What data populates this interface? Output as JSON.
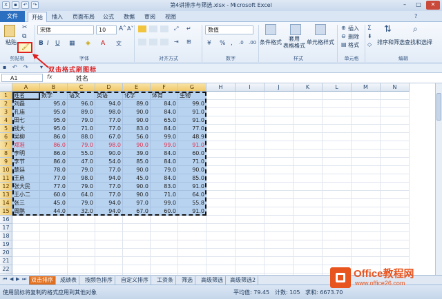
{
  "window": {
    "title": "第4讲排序与筛选.xlsx - Microsoft Excel",
    "minimize": "–",
    "maximize": "□",
    "close": "✕"
  },
  "tabs": [
    "文件",
    "开始",
    "插入",
    "页面布局",
    "公式",
    "数据",
    "审阅",
    "视图"
  ],
  "ribbon": {
    "paste": "粘贴",
    "font_name": "宋体",
    "font_size": "10",
    "number_format": "数值",
    "conditional_format": "条件格式",
    "table_format": "套用\n表格格式",
    "cell_styles": "单元格样式",
    "insert": "插入",
    "delete": "删除",
    "format": "格式",
    "sort_filter": "排序和筛选",
    "find_select": "查找和选择",
    "groups": [
      "剪贴板",
      "字体",
      "对齐方式",
      "数字",
      "样式",
      "单元格",
      "编辑"
    ]
  },
  "annotation": "双击格式刷图标",
  "formula_bar": {
    "name_box": "A1",
    "fx": "fx",
    "value": "姓名"
  },
  "columns": [
    "A",
    "B",
    "C",
    "D",
    "E",
    "F",
    "G",
    "H",
    "I",
    "J",
    "K",
    "L",
    "M",
    "N"
  ],
  "row_numbers": [
    "1",
    "2",
    "3",
    "4",
    "5",
    "6",
    "7",
    "8",
    "9",
    "10",
    "11",
    "12",
    "13",
    "14",
    "15",
    "16",
    "17",
    "18",
    "19",
    "20",
    "21",
    "22",
    "23"
  ],
  "table": {
    "headers": [
      "姓名",
      "数学",
      "语文",
      "英语",
      "化学",
      "体育",
      "生物"
    ],
    "rows": [
      [
        "刘磊",
        "95.0",
        "96.0",
        "94.0",
        "89.0",
        "84.0",
        "99.0"
      ],
      [
        "孔庙",
        "95.0",
        "89.0",
        "98.0",
        "90.0",
        "84.0",
        "91.0"
      ],
      [
        "田七",
        "95.0",
        "79.0",
        "77.0",
        "90.0",
        "65.0",
        "91.0"
      ],
      [
        "钱大",
        "95.0",
        "71.0",
        "77.0",
        "83.0",
        "84.0",
        "77.0"
      ],
      [
        "吴柳",
        "86.0",
        "88.0",
        "67.0",
        "56.0",
        "99.0",
        "48.9"
      ],
      [
        "郑准",
        "86.0",
        "79.0",
        "98.0",
        "90.0",
        "99.0",
        "91.0"
      ],
      [
        "李明",
        "86.0",
        "55.0",
        "90.0",
        "39.0",
        "84.0",
        "60.0"
      ],
      [
        "李节",
        "86.0",
        "47.0",
        "54.0",
        "85.0",
        "84.0",
        "71.0"
      ],
      [
        "楚廷",
        "78.0",
        "79.0",
        "77.0",
        "90.0",
        "79.0",
        "90.0"
      ],
      [
        "王启",
        "77.0",
        "98.0",
        "94.0",
        "45.0",
        "84.0",
        "85.0"
      ],
      [
        "张大民",
        "77.0",
        "79.0",
        "77.0",
        "90.0",
        "83.0",
        "91.0"
      ],
      [
        "王小二",
        "60.0",
        "64.0",
        "77.0",
        "90.0",
        "71.0",
        "64.0"
      ],
      [
        "张三",
        "45.0",
        "79.0",
        "94.0",
        "97.0",
        "99.0",
        "55.8"
      ],
      [
        "周鹏",
        "44.0",
        "32.0",
        "94.0",
        "67.0",
        "60.0",
        "91.0"
      ]
    ]
  },
  "sheet_tabs": [
    "双击排序",
    "成绩表",
    "按颜色排序",
    "自定义排序",
    "工资条",
    "筛选",
    "高级筛选",
    "高级筛选2"
  ],
  "status": {
    "message": "使用鼠标将复制的格式应用到其他对象",
    "average": "平均值: 79.45",
    "count": "计数: 105",
    "sum": "求和: 6673.70"
  },
  "watermark": {
    "title": "Office教程网",
    "url": "www.office26.com"
  },
  "colors": {
    "accent": "#2a6fc0",
    "selection": "#b8d3f0",
    "highlight_text": "#e0304d",
    "annotation": "#e02020",
    "active_sheet_tab": "#e0701f"
  }
}
